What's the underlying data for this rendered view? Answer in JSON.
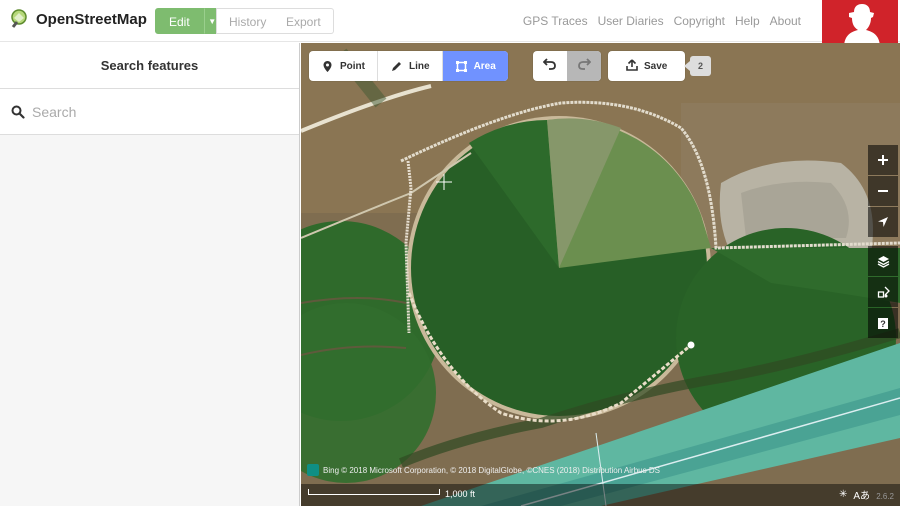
{
  "brand": {
    "name": "OpenStreetMap"
  },
  "topbar": {
    "edit_label": "Edit",
    "history_label": "History",
    "export_label": "Export",
    "nav": [
      "GPS Traces",
      "User Diaries",
      "Copyright",
      "Help",
      "About"
    ]
  },
  "sidebar": {
    "title": "Search features",
    "search_placeholder": "Search",
    "watermark": "(faded overlay text)"
  },
  "map_toolbar": {
    "modes": [
      {
        "label": "Point",
        "icon": "marker-icon",
        "active": false
      },
      {
        "label": "Line",
        "icon": "pencil-icon",
        "active": false
      },
      {
        "label": "Area",
        "icon": "area-icon",
        "active": true
      }
    ],
    "save_label": "Save",
    "pending_count": "2"
  },
  "map": {
    "attribution": "Bing  © 2018 Microsoft Corporation, © 2018 DigitalGlobe, ©CNES (2018) Distribution Airbus DS",
    "scale_label": "1,000 ft",
    "version": "2.6.2",
    "accent_color": "#7092ff",
    "edit_color": "#7ebc6f",
    "user_badge_color": "#d0232a"
  }
}
